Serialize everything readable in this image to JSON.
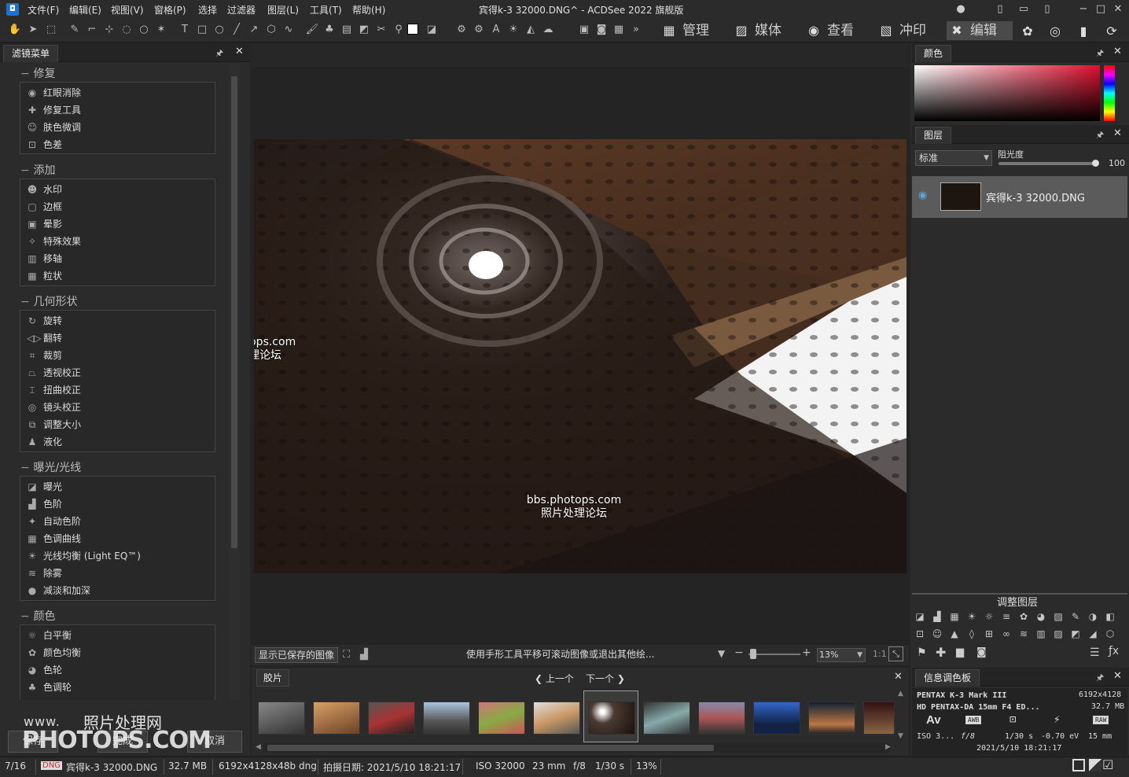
{
  "app_title": "宾得k-3 32000.DNG^ - ACDSee 2022 旗舰版",
  "menus": [
    "文件(F)",
    "编辑(E)",
    "视图(V)",
    "窗格(P)",
    "选择",
    "过滤器",
    "图层(L)",
    "工具(T)",
    "帮助(H)"
  ],
  "modes": {
    "manage": "管理",
    "media": "媒体",
    "view": "查看",
    "print": "冲印",
    "edit": "编辑"
  },
  "filter_panel": {
    "tab": "滤镜菜单",
    "groups": [
      {
        "title": "修复",
        "items": [
          "红眼消除",
          "修复工具",
          "肤色微调",
          "色差"
        ]
      },
      {
        "title": "添加",
        "items": [
          "水印",
          "边框",
          "晕影",
          "特殊效果",
          "移轴",
          "粒状"
        ]
      },
      {
        "title": "几何形状",
        "items": [
          "旋转",
          "翻转",
          "裁剪",
          "透视校正",
          "扭曲校正",
          "镜头校正",
          "调整大小",
          "液化"
        ]
      },
      {
        "title": "曝光/光线",
        "items": [
          "曝光",
          "色阶",
          "自动色阶",
          "色调曲线",
          "光线均衡 (Light EQ™)",
          "除雾",
          "减淡和加深"
        ]
      },
      {
        "title": "颜色",
        "items": [
          "白平衡",
          "颜色均衡",
          "色轮",
          "色调轮"
        ]
      }
    ],
    "buttons": {
      "save": "保存",
      "done": "完成",
      "cancel": "取消"
    }
  },
  "watermarks": {
    "forum_url": "bbs.photops.com",
    "forum_cn": "照片处理论坛",
    "site_www": "www.",
    "site_cn": "照片处理网",
    "site_big": "PHOTOPS.COM"
  },
  "image_bar": {
    "show_saved": "显示已保存的图像",
    "hint": "使用手形工具平移可滚动图像或退出其他绘...",
    "zoom": "13%",
    "ratio": "1:1"
  },
  "filmstrip": {
    "tab": "胶片",
    "prev": "上一个",
    "next": "下一个",
    "thumb_count": 12,
    "selected_index": 6
  },
  "color_panel": {
    "tab": "颜色"
  },
  "layers_panel": {
    "tab": "图层",
    "blend_mode": "标准",
    "opacity_label": "阻光度",
    "opacity_value": "100",
    "layer_name": "宾得k-3 32000.DNG",
    "opacity_fraction": 1.0
  },
  "adjust_layers": {
    "title": "调整图层"
  },
  "info_panel": {
    "tab": "信息调色板",
    "camera": "PENTAX K-3 Mark III",
    "dims": "6192x4128",
    "lens": "HD PENTAX-DA 15mm F4 ED...",
    "size": "32.7 MB",
    "mode": "Av",
    "wb": "AWB",
    "raw": "RAW",
    "iso": "ISO 3...",
    "aperture": "f/8",
    "shutter": "1/30 s",
    "ev": "-0.70 eV",
    "focal": "15 mm",
    "date": "2021/5/10 18:21:17"
  },
  "statusbar": {
    "index": "7/16",
    "type": "DNG",
    "filename": "宾得k-3 32000.DNG",
    "size": "32.7 MB",
    "dims": "6192x4128x48b dng",
    "shot_date": "拍摄日期: 2021/5/10 18:21:17",
    "iso": "ISO 32000",
    "focal": "23 mm",
    "aperture": "f/8",
    "shutter": "1/30 s",
    "zoom": "13%"
  },
  "colors": {
    "accent": "#1e6fd0",
    "bg": "#2b2b2b",
    "selected_layer": "#5b5b5b"
  }
}
